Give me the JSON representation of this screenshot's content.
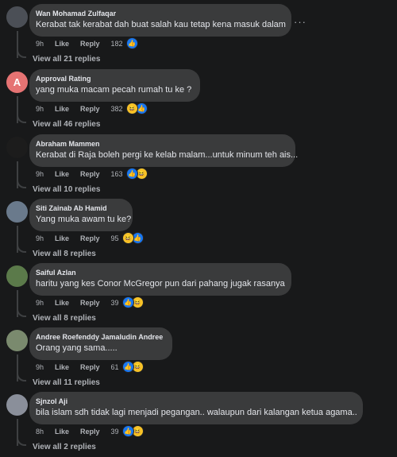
{
  "comments": [
    {
      "author": "Wan Mohamad Zulfaqar",
      "text": "Kerabat tak kerabat dah buat salah kau tetap kena masuk dalam",
      "time": "9h",
      "like_label": "Like",
      "reply_label": "Reply",
      "reaction_count": "182",
      "reactions": [
        "like-icon"
      ],
      "view_replies": "View all 21 replies",
      "avatar_letter": "",
      "avatar_color": "#4b4f56"
    },
    {
      "author": "Approval Rating",
      "text": "yang muka macam pecah rumah tu ke ?",
      "time": "9h",
      "like_label": "Like",
      "reply_label": "Reply",
      "reaction_count": "382",
      "reactions": [
        "haha-icon",
        "like-icon"
      ],
      "view_replies": "View all 46 replies",
      "avatar_letter": "A",
      "avatar_color": "#e57373"
    },
    {
      "author": "Abraham Mammen",
      "text": "Kerabat di Raja boleh pergi ke kelab malam...untuk minum teh ais...",
      "time": "9h",
      "like_label": "Like",
      "reply_label": "Reply",
      "reaction_count": "163",
      "reactions": [
        "like-icon",
        "haha-icon"
      ],
      "view_replies": "View all 10 replies",
      "avatar_letter": "",
      "avatar_color": "#1c1c1c"
    },
    {
      "author": "Siti Zainab Ab Hamid",
      "text": "Yang muka awam tu ke?",
      "time": "9h",
      "like_label": "Like",
      "reply_label": "Reply",
      "reaction_count": "95",
      "reactions": [
        "haha-icon",
        "like-icon"
      ],
      "view_replies": "View all 8 replies",
      "avatar_letter": "",
      "avatar_color": "#6a7a8c"
    },
    {
      "author": "Saiful Azlan",
      "text": "haritu yang kes Conor McGregor pun dari pahang jugak rasanya",
      "time": "9h",
      "like_label": "Like",
      "reply_label": "Reply",
      "reaction_count": "39",
      "reactions": [
        "like-icon",
        "haha-icon"
      ],
      "view_replies": "View all 8 replies",
      "avatar_letter": "",
      "avatar_color": "#5b7a4a"
    },
    {
      "author": "Andree Roefenddy Jamaludin Andree",
      "text": "Orang yang sama.....",
      "time": "9h",
      "like_label": "Like",
      "reply_label": "Reply",
      "reaction_count": "61",
      "reactions": [
        "like-icon",
        "haha-icon"
      ],
      "view_replies": "View all 11 replies",
      "avatar_letter": "",
      "avatar_color": "#7a8a6e"
    },
    {
      "author": "Sjnzol Aji",
      "text": "bila islam sdh tidak lagi menjadi pegangan.. walaupun dari kalangan ketua agama..",
      "time": "8h",
      "like_label": "Like",
      "reply_label": "Reply",
      "reaction_count": "39",
      "reactions": [
        "like-icon",
        "haha-icon"
      ],
      "view_replies": "View all 2 replies",
      "avatar_letter": "",
      "avatar_color": "#8a8f9a"
    }
  ],
  "more_icon": "more-options-icon",
  "more_glyph": "···",
  "reaction_glyphs": {
    "like-icon": "👍",
    "haha-icon": "😆"
  }
}
